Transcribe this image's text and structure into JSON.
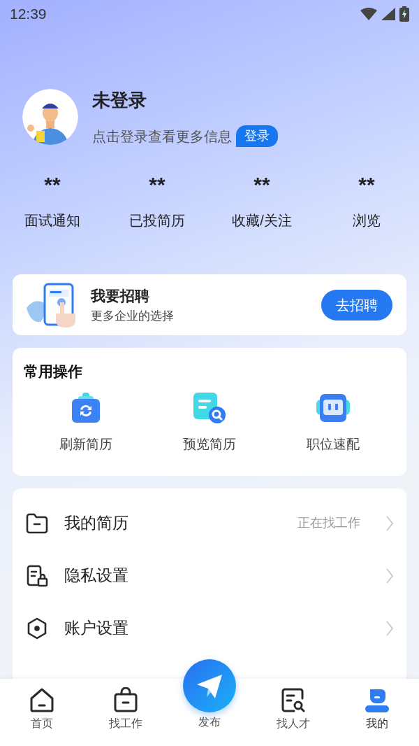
{
  "status_bar": {
    "time": "12:39"
  },
  "profile": {
    "name": "未登录",
    "hint": "点击登录查看更多信息",
    "login_button": "登录"
  },
  "stats": [
    {
      "value": "**",
      "label": "面试通知"
    },
    {
      "value": "**",
      "label": "已投简历"
    },
    {
      "value": "**",
      "label": "收藏/关注"
    },
    {
      "value": "**",
      "label": "浏览"
    }
  ],
  "recruit_card": {
    "title": "我要招聘",
    "subtitle": "更多企业的选择",
    "button": "去招聘"
  },
  "common_actions": {
    "title": "常用操作",
    "items": [
      {
        "kind": "refresh",
        "label": "刷新简历"
      },
      {
        "kind": "preview",
        "label": "预览简历"
      },
      {
        "kind": "match",
        "label": "职位速配"
      }
    ]
  },
  "menu": [
    {
      "kind": "resume",
      "label": "我的简历",
      "value": "正在找工作"
    },
    {
      "kind": "privacy",
      "label": "隐私设置"
    },
    {
      "kind": "account",
      "label": "账户设置"
    }
  ],
  "bottom_nav": [
    {
      "kind": "home",
      "label": "首页",
      "selected": false
    },
    {
      "kind": "jobs",
      "label": "找工作",
      "selected": false
    },
    {
      "kind": "publish",
      "label": "发布",
      "selected": false
    },
    {
      "kind": "talent",
      "label": "找人才",
      "selected": false
    },
    {
      "kind": "me",
      "label": "我的",
      "selected": true
    }
  ]
}
